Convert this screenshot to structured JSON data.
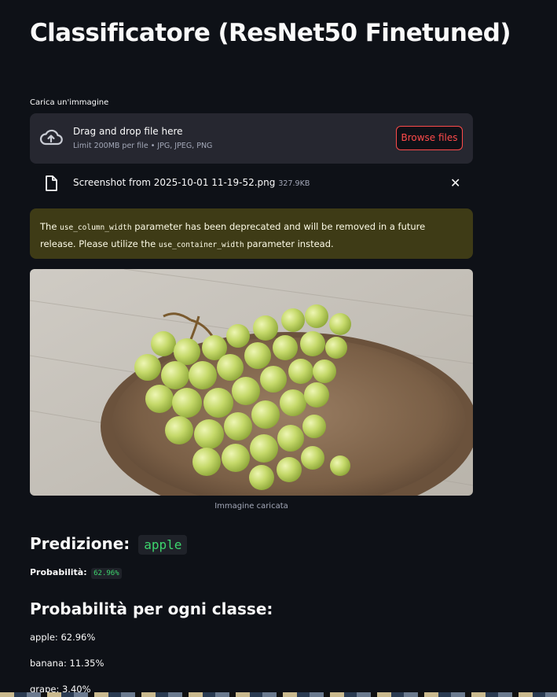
{
  "header": {
    "title": "Classificatore (ResNet50 Finetuned)"
  },
  "uploader": {
    "label": "Carica un'immagine",
    "drop_title": "Drag and drop file here",
    "drop_subtitle": "Limit 200MB per file • JPG, JPEG, PNG",
    "browse_label": "Browse files",
    "file_name": "Screenshot from 2025-10-01 11-19-52.png",
    "file_size": "327.9KB",
    "close_glyph": "✕",
    "icons": {
      "upload": "cloud-upload-icon",
      "file": "file-icon",
      "close": "close-icon"
    }
  },
  "warning": {
    "text_1": "The ",
    "code_1": "use_column_width",
    "text_2": " parameter has been deprecated and will be removed in a future release. Please utilize the ",
    "code_2": "use_container_width",
    "text_3": " parameter instead."
  },
  "image": {
    "caption": "Immagine caricata"
  },
  "prediction": {
    "heading": "Predizione:",
    "label": "apple",
    "prob_label": "Probabilità:",
    "prob_value": "62.96%"
  },
  "classes": {
    "heading": "Probabilità per ogni classe:",
    "items": [
      "apple: 62.96%",
      "banana: 11.35%",
      "grape: 3.40%"
    ]
  },
  "colors": {
    "background": "#0e1117",
    "surface": "#262730",
    "accent": "#ff4b4b",
    "code_green": "#3dd56d",
    "warning_bg": "#3e3b16"
  }
}
